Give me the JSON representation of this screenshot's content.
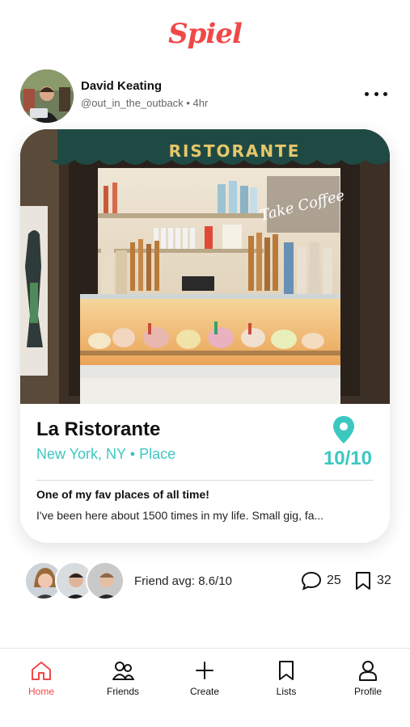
{
  "app": {
    "logo": "Spiel",
    "brand_color": "#f04848",
    "accent_color": "#3cc8c0"
  },
  "post": {
    "author_name": "David Keating",
    "author_handle": "@out_in_the_outback",
    "separator": "•",
    "time_ago": "4hr",
    "photo_signs": {
      "awning": "RISTORANTE",
      "window": "Take Coffee"
    },
    "place_name": "La Ristorante",
    "place_location": "New York, NY",
    "place_type": "Place",
    "score": "10/10",
    "review_title": "One of my fav places of all time!",
    "review_body": "I've been here about 1500 times in my life. Small gig, fa..."
  },
  "social": {
    "friend_avg": "Friend avg: 8.6/10",
    "comments": "25",
    "saves": "32"
  },
  "nav": {
    "items": [
      {
        "label": "Home",
        "icon": "home-icon",
        "active": true
      },
      {
        "label": "Friends",
        "icon": "friends-icon",
        "active": false
      },
      {
        "label": "Create",
        "icon": "plus-icon",
        "active": false
      },
      {
        "label": "Lists",
        "icon": "bookmark-icon",
        "active": false
      },
      {
        "label": "Profile",
        "icon": "person-icon",
        "active": false
      }
    ]
  }
}
